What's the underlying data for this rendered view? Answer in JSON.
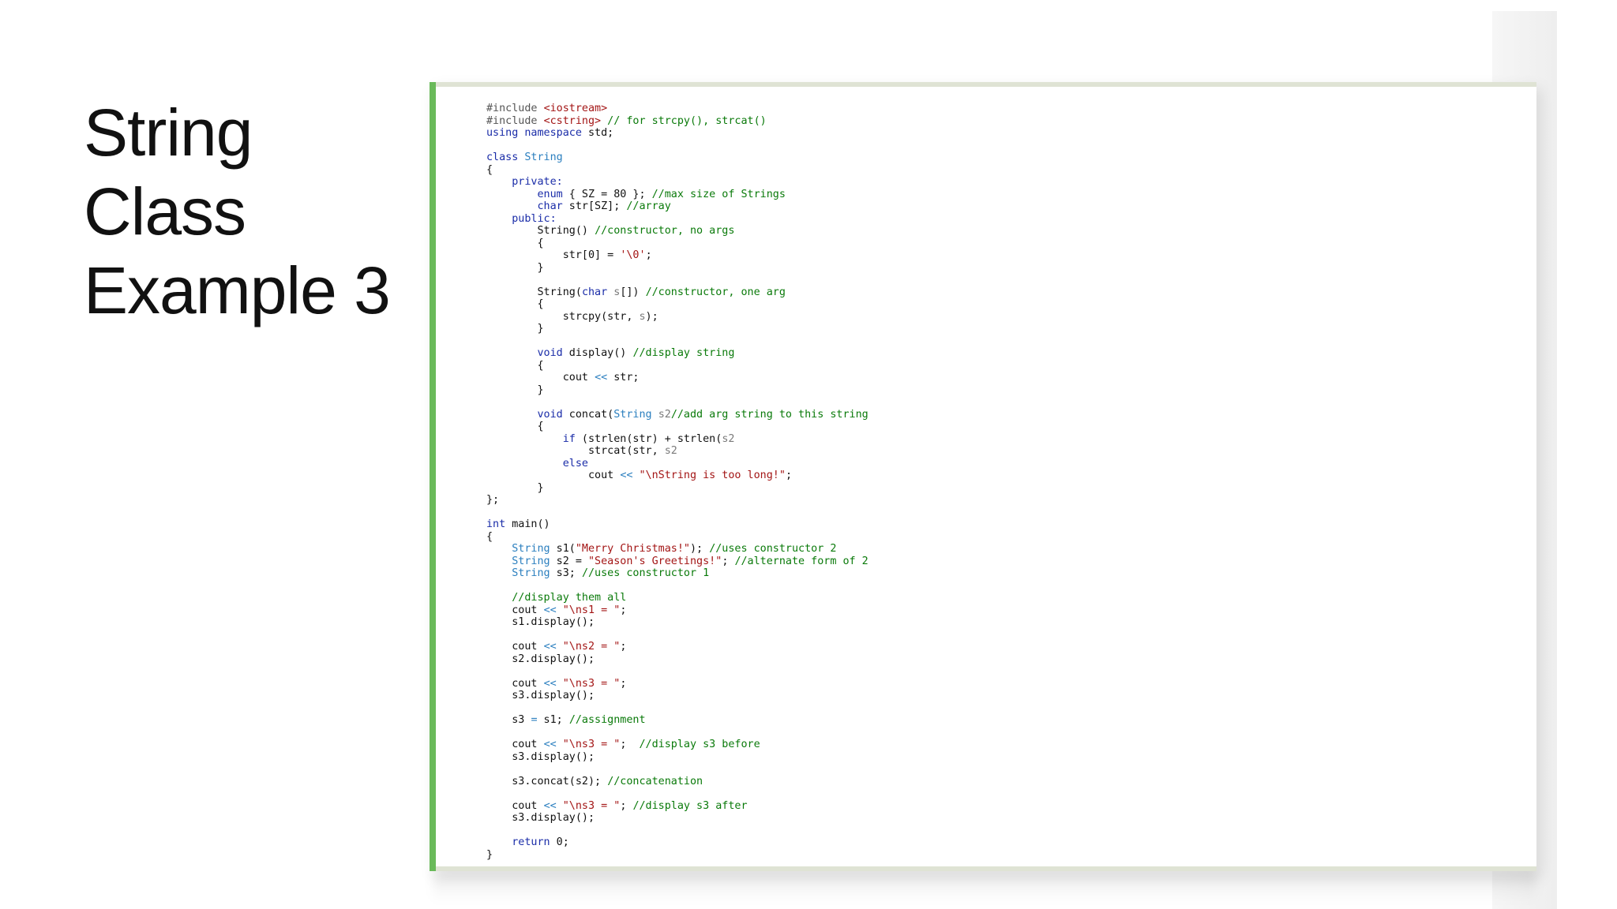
{
  "slide": {
    "title_lines": [
      "String",
      "Class",
      "Example 3"
    ]
  },
  "colors": {
    "default": "#111111",
    "preproc": "#555555",
    "keyword": "#1a2ca8",
    "type": "#2b7fbf",
    "string": "#a31515",
    "comment": "#0a7a0a",
    "param": "#7a7a7a",
    "accent_bar": "#6aba5a"
  },
  "code": {
    "lines": [
      [
        [
          "pp",
          "#include "
        ],
        [
          "st",
          "<iostream>"
        ]
      ],
      [
        [
          "pp",
          "#include "
        ],
        [
          "st",
          "<cstring>"
        ],
        [
          "cm",
          " // for strcpy(), strcat()"
        ]
      ],
      [
        [
          "kw",
          "using namespace "
        ],
        [
          "",
          "std;"
        ]
      ],
      [],
      [
        [
          "kw",
          "class "
        ],
        [
          "ty",
          "String"
        ]
      ],
      [
        [
          "",
          "{"
        ]
      ],
      [
        [
          "",
          "    "
        ],
        [
          "kw",
          "private:"
        ]
      ],
      [
        [
          "",
          "        "
        ],
        [
          "kw",
          "enum"
        ],
        [
          "",
          " { SZ = 80 }; "
        ],
        [
          "cm",
          "//max size of Strings"
        ]
      ],
      [
        [
          "",
          "        "
        ],
        [
          "kw",
          "char"
        ],
        [
          "",
          " str[SZ]; "
        ],
        [
          "cm",
          "//array"
        ]
      ],
      [
        [
          "",
          "    "
        ],
        [
          "kw",
          "public:"
        ]
      ],
      [
        [
          "",
          "        String() "
        ],
        [
          "cm",
          "//constructor, no args"
        ]
      ],
      [
        [
          "",
          "        {"
        ]
      ],
      [
        [
          "",
          "            str[0] = "
        ],
        [
          "st",
          "'\\0'"
        ],
        [
          "",
          ";"
        ]
      ],
      [
        [
          "",
          "        }"
        ]
      ],
      [],
      [
        [
          "",
          "        String("
        ],
        [
          "kw",
          "char"
        ],
        [
          "",
          " "
        ],
        [
          "pa",
          "s"
        ],
        [
          "",
          "[]) "
        ],
        [
          "cm",
          "//constructor, one arg"
        ]
      ],
      [
        [
          "",
          "        {"
        ]
      ],
      [
        [
          "",
          "            strcpy(str, "
        ],
        [
          "pa",
          "s"
        ],
        [
          "",
          ");"
        ]
      ],
      [
        [
          "",
          "        }"
        ]
      ],
      [],
      [
        [
          "",
          "        "
        ],
        [
          "kw",
          "void"
        ],
        [
          "",
          " display() "
        ],
        [
          "cm",
          "//display string"
        ]
      ],
      [
        [
          "",
          "        {"
        ]
      ],
      [
        [
          "",
          "            cout "
        ],
        [
          "ty",
          "<<"
        ],
        [
          "",
          " str;"
        ]
      ],
      [
        [
          "",
          "        }"
        ]
      ],
      [],
      [
        [
          "",
          "        "
        ],
        [
          "kw",
          "void"
        ],
        [
          "",
          " concat("
        ],
        [
          "ty",
          "String"
        ],
        [
          "",
          " "
        ],
        [
          "pa",
          "s2"
        ],
        [
          ") "
        ],
        [
          "cm",
          "//add arg string to this string"
        ]
      ],
      [
        [
          "",
          "        {"
        ]
      ],
      [
        [
          "",
          "            "
        ],
        [
          "kw",
          "if"
        ],
        [
          "",
          " (strlen(str) + strlen("
        ],
        [
          "pa",
          "s2"
        ],
        [
          ".str) < SZ)"
        ]
      ],
      [
        [
          "",
          "                strcat(str, "
        ],
        [
          "pa",
          "s2"
        ],
        [
          ".str);"
        ]
      ],
      [
        [
          "",
          "            "
        ],
        [
          "kw",
          "else"
        ]
      ],
      [
        [
          "",
          "                cout "
        ],
        [
          "ty",
          "<<"
        ],
        [
          "",
          " "
        ],
        [
          "st",
          "\"\\nString is too long!\""
        ],
        [
          "",
          ";"
        ]
      ],
      [
        [
          "",
          "        }"
        ]
      ],
      [
        [
          "",
          "};"
        ]
      ],
      [],
      [
        [
          "kw",
          "int"
        ],
        [
          "",
          " main()"
        ]
      ],
      [
        [
          "",
          "{"
        ]
      ],
      [
        [
          "",
          "    "
        ],
        [
          "ty",
          "String"
        ],
        [
          "",
          " s1("
        ],
        [
          "st",
          "\"Merry Christmas!\""
        ],
        [
          "",
          "); "
        ],
        [
          "cm",
          "//uses constructor 2"
        ]
      ],
      [
        [
          "",
          "    "
        ],
        [
          "ty",
          "String"
        ],
        [
          "",
          " s2 = "
        ],
        [
          "st",
          "\"Season's Greetings!\""
        ],
        [
          "",
          "; "
        ],
        [
          "cm",
          "//alternate form of 2"
        ]
      ],
      [
        [
          "",
          "    "
        ],
        [
          "ty",
          "String"
        ],
        [
          "",
          " s3; "
        ],
        [
          "cm",
          "//uses constructor 1"
        ]
      ],
      [],
      [
        [
          "",
          "    "
        ],
        [
          "cm",
          "//display them all"
        ]
      ],
      [
        [
          "",
          "    cout "
        ],
        [
          "ty",
          "<<"
        ],
        [
          "",
          " "
        ],
        [
          "st",
          "\"\\ns1 = \""
        ],
        [
          "",
          ";"
        ]
      ],
      [
        [
          "",
          "    s1.display();"
        ]
      ],
      [],
      [
        [
          "",
          "    cout "
        ],
        [
          "ty",
          "<<"
        ],
        [
          "",
          " "
        ],
        [
          "st",
          "\"\\ns2 = \""
        ],
        [
          "",
          ";"
        ]
      ],
      [
        [
          "",
          "    s2.display();"
        ]
      ],
      [],
      [
        [
          "",
          "    cout "
        ],
        [
          "ty",
          "<<"
        ],
        [
          "",
          " "
        ],
        [
          "st",
          "\"\\ns3 = \""
        ],
        [
          "",
          ";"
        ]
      ],
      [
        [
          "",
          "    s3.display();"
        ]
      ],
      [],
      [
        [
          "",
          "    s3 "
        ],
        [
          "ty",
          "="
        ],
        [
          "",
          " s1; "
        ],
        [
          "cm",
          "//assignment"
        ]
      ],
      [],
      [
        [
          "",
          "    cout "
        ],
        [
          "ty",
          "<<"
        ],
        [
          "",
          " "
        ],
        [
          "st",
          "\"\\ns3 = \""
        ],
        [
          "",
          ";  "
        ],
        [
          "cm",
          "//display s3 before"
        ]
      ],
      [
        [
          "",
          "    s3.display();"
        ]
      ],
      [],
      [
        [
          "",
          "    s3.concat(s2); "
        ],
        [
          "cm",
          "//concatenation"
        ]
      ],
      [],
      [
        [
          "",
          "    cout "
        ],
        [
          "ty",
          "<<"
        ],
        [
          "",
          " "
        ],
        [
          "st",
          "\"\\ns3 = \""
        ],
        [
          "",
          "; "
        ],
        [
          "cm",
          "//display s3 after"
        ]
      ],
      [
        [
          "",
          "    s3.display();"
        ]
      ],
      [],
      [
        [
          "",
          "    "
        ],
        [
          "kw",
          "return"
        ],
        [
          "",
          " 0;"
        ]
      ],
      [
        [
          "",
          "}"
        ]
      ]
    ]
  }
}
